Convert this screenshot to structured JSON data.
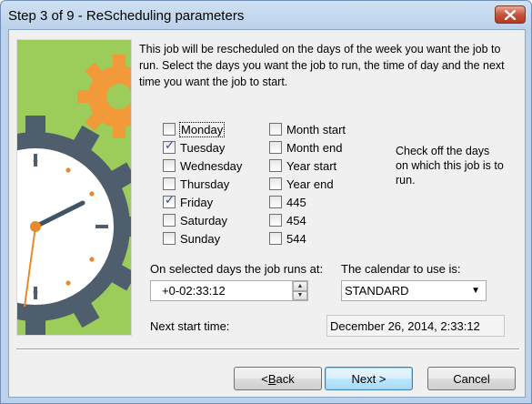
{
  "window": {
    "title": "Step 3 of 9 - ReScheduling parameters"
  },
  "intro_text": "This job will be rescheduled on the days of the week you want the job to run. Select the days you want the job to run, the time of day and the next time you want the job to start.",
  "days": [
    {
      "label": "Monday",
      "checked": false
    },
    {
      "label": "Tuesday",
      "checked": true
    },
    {
      "label": "Wednesday",
      "checked": false
    },
    {
      "label": "Thursday",
      "checked": false
    },
    {
      "label": "Friday",
      "checked": true
    },
    {
      "label": "Saturday",
      "checked": false
    },
    {
      "label": "Sunday",
      "checked": false
    }
  ],
  "periods": [
    {
      "label": "Month start",
      "checked": false
    },
    {
      "label": "Month end",
      "checked": false
    },
    {
      "label": "Year start",
      "checked": false
    },
    {
      "label": "Year end",
      "checked": false
    },
    {
      "label": "445",
      "checked": false
    },
    {
      "label": "454",
      "checked": false
    },
    {
      "label": "544",
      "checked": false
    }
  ],
  "hint_text": "Check off the days on which this job is to run.",
  "run_time": {
    "label": "On selected days the job runs at:",
    "value": "+0-02:33:12"
  },
  "calendar": {
    "label": "The calendar to use is:",
    "value": "STANDARD"
  },
  "next_start": {
    "label": "Next start time:",
    "value": "December 26, 2014,  2:33:12"
  },
  "buttons": {
    "back_prefix": "<",
    "back_underlined": "B",
    "back_rest": "ack",
    "next": "Next >",
    "cancel": "Cancel"
  },
  "colors": {
    "illustration_bg": "#9ccc5a",
    "gear_orange": "#f29a3a",
    "gear_slate": "#4f5e6d",
    "clock_face": "#ffffff",
    "clock_hand": "#3d5566",
    "accent_dots": "#e8892c"
  },
  "icons": {
    "close": "close-icon",
    "check": "check-mark-icon",
    "spin_up": "triangle-up-icon",
    "spin_down": "triangle-down-icon",
    "dropdown": "chevron-down-icon"
  }
}
